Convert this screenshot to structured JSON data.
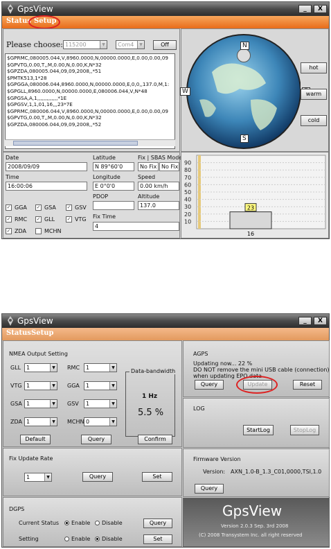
{
  "top": {
    "title": "GpsView",
    "min_label": "_",
    "close_label": "X",
    "menu": [
      "Status",
      "Setup"
    ],
    "choose_label": "Please choose:",
    "baud_value": "115200",
    "port_value": "Com4",
    "off_label": "Off",
    "nmea_lines": [
      "$GPRMC,080005.044,V,8960.0000,N,00000.0000,E,0.00,0.00,09",
      "$GPVTG,0.00,T,,M,0.00,N,0.00,K,N*32",
      "$GPZDA,080005.044,09,09,2008,,*51",
      "$PMTK513,1*28",
      "$GPGGA,080006.044,8960.0000,N,00000.0000,E,0,0,,137.0,M,1:",
      "$GPGLL,8960.0000,N,00000.0000,E,080006.044,V,N*48",
      "$GPGSA,A,1,,,,,,,,,,,,,*1E",
      "$GPGSV,1,1,01,16,,,23*7E",
      "$GPRMC,080006.044,V,8960.0000,N,00000.0000,E,0.00,0.00,09",
      "$GPVTG,0.00,T,,M,0.00,N,0.00,K,N*32",
      "$GPZDA,080006.044,09,09,2008,,*52"
    ],
    "compass": {
      "n": "N",
      "s": "S",
      "e": "E",
      "w": "W"
    },
    "start_buttons": [
      "hot",
      "warm",
      "cold"
    ],
    "fields": {
      "date_label": "Date",
      "date_value": "2008/09/09",
      "lat_label": "Latitude",
      "lat_value": "N 89°60'0",
      "fix_label": "Fix | SBAS Mode",
      "fix_value": "No Fix",
      "sbas_value": "No Fix",
      "time_label": "Time",
      "time_value": "16:00:06",
      "lon_label": "Longitude",
      "lon_value": "E 0°0'0",
      "speed_label": "Speed",
      "speed_value": "0.00 km/h",
      "pdop_label": "PDOP",
      "pdop_value": "",
      "alt_label": "Altitude",
      "alt_value": "137.0",
      "fixtime_label": "Fix Time",
      "fixtime_value": "4"
    },
    "checks": [
      {
        "label": "GGA",
        "checked": true
      },
      {
        "label": "GSA",
        "checked": true
      },
      {
        "label": "GSV",
        "checked": true
      },
      {
        "label": "RMC",
        "checked": true
      },
      {
        "label": "GLL",
        "checked": true
      },
      {
        "label": "VTG",
        "checked": true
      },
      {
        "label": "ZDA",
        "checked": true
      },
      {
        "label": "MCHN",
        "checked": false
      }
    ]
  },
  "chart_data": {
    "type": "bar",
    "categories": [
      "16"
    ],
    "values": [
      23
    ],
    "ylim": [
      0,
      100
    ],
    "yticks": [
      "90",
      "80",
      "70",
      "60",
      "50",
      "40",
      "30",
      "20",
      "10"
    ],
    "value_label": "23"
  },
  "bottom": {
    "title": "GpsView",
    "menu": [
      "Status",
      "Setup"
    ],
    "nmea_title": "NMEA Output Setting",
    "nmea_rows": [
      {
        "l1": "GLL",
        "v1": "1",
        "l2": "RMC",
        "v2": "1"
      },
      {
        "l1": "VTG",
        "v1": "1",
        "l2": "GGA",
        "v2": "1"
      },
      {
        "l1": "GSA",
        "v1": "1",
        "l2": "GSV",
        "v2": "1"
      },
      {
        "l1": "ZDA",
        "v1": "1",
        "l2": "MCHN",
        "v2": "0"
      }
    ],
    "bandwidth_title": "Data-bandwidth",
    "bw_hz": "1  Hz",
    "bw_pct": "5.5  %",
    "default_label": "Default",
    "query_label": "Query",
    "confirm_label": "Confirm",
    "fix_title": "Fix Update Rate",
    "fix_value": "1",
    "set_label": "Set",
    "dgps_title": "DGPS",
    "current_status": "Current Status",
    "setting": "Setting",
    "enable": "Enable",
    "disable": "Disable",
    "agps_title": "AGPS",
    "agps_msg1": "Updating now... 22 %",
    "agps_msg2": "DO NOT remove the mini USB cable (connection)",
    "agps_msg3": "when updating EPO data",
    "update_label": "Update",
    "reset_label": "Reset",
    "log_title": "LOG",
    "startlog_label": "StartLog",
    "stoplog_label": "StopLog",
    "fw_title": "Firmware Version",
    "fw_label": "Version:",
    "fw_value": "AXN_1.0-B_1.3_C01,0000,TSI,1.0",
    "brand": "GpsView",
    "brand_version": "Version 2.0.3    Sep. 3rd 2008",
    "copyright": "(C) 2008 Transystem Inc. all right reserved"
  }
}
